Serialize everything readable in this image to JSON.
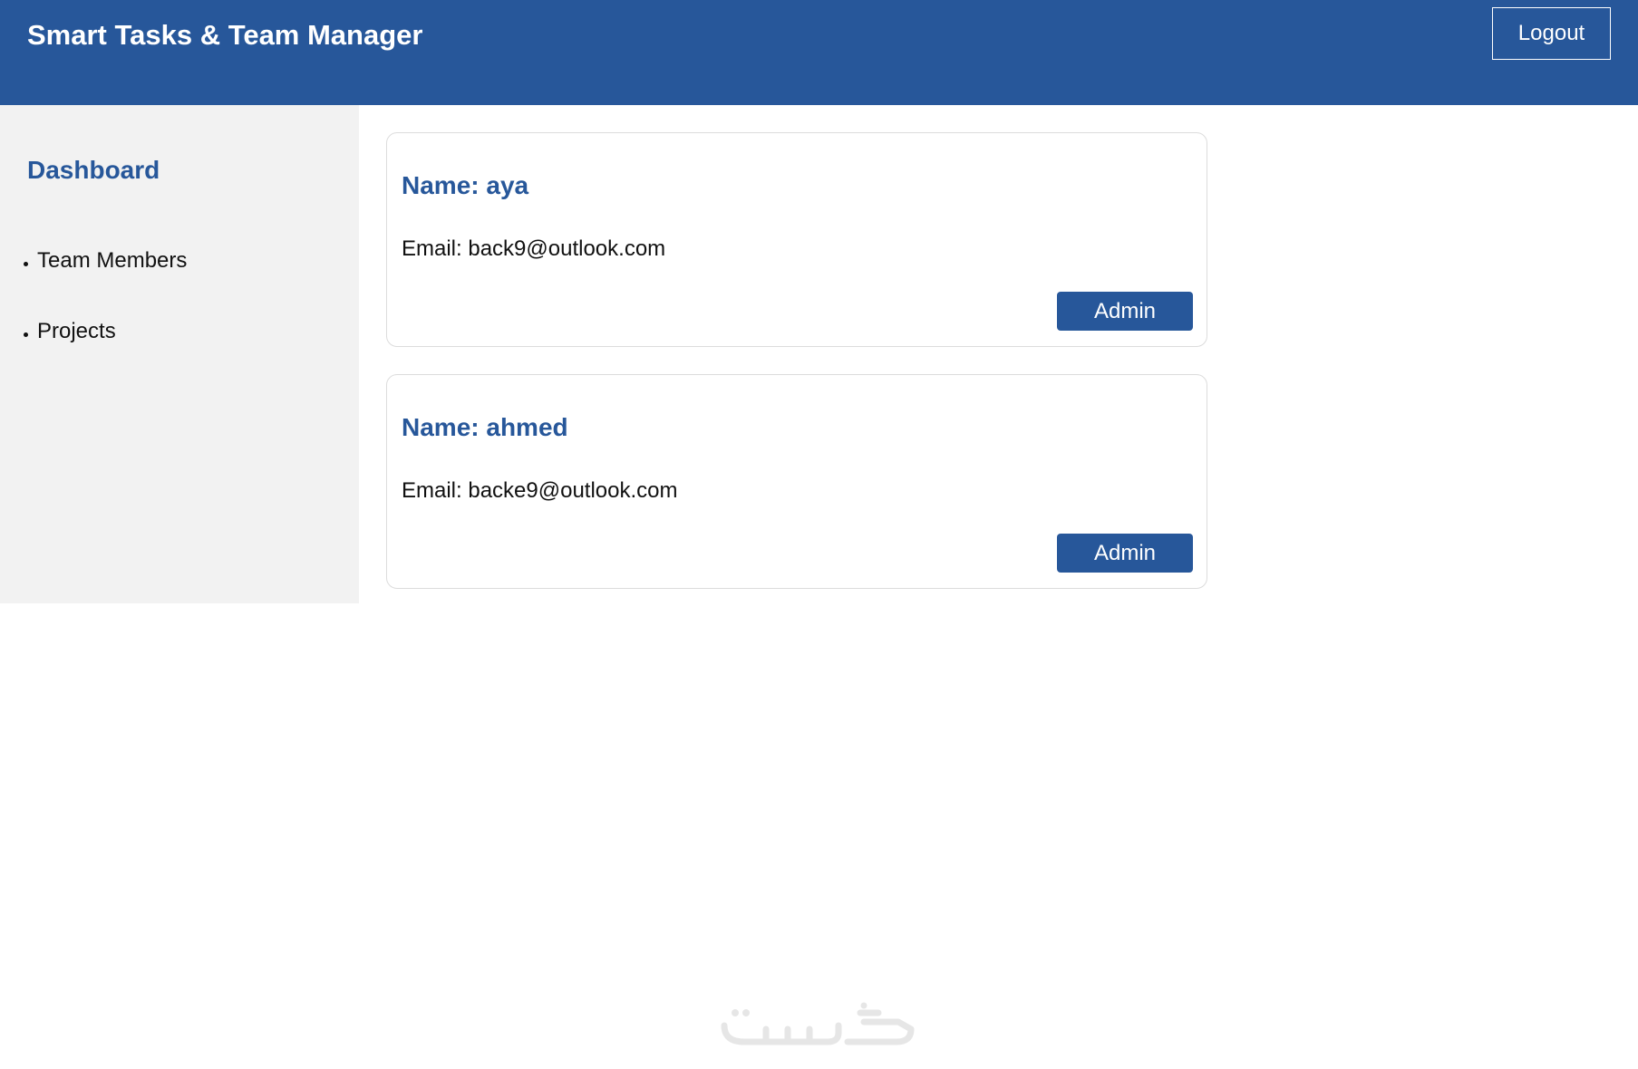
{
  "header": {
    "title": "Smart Tasks & Team Manager",
    "logout_label": "Logout",
    "background_color": "#27579a"
  },
  "sidebar": {
    "title": "Dashboard",
    "items": [
      {
        "label": "Team Members"
      },
      {
        "label": "Projects"
      }
    ]
  },
  "members": [
    {
      "name": "Name: aya",
      "email": "Email: back9@outlook.com",
      "role_label": "Admin"
    },
    {
      "name": "Name: ahmed",
      "email": "Email: backe9@outlook.com",
      "role_label": "Admin"
    }
  ],
  "watermark": {
    "logo": "khamsat-logo"
  }
}
